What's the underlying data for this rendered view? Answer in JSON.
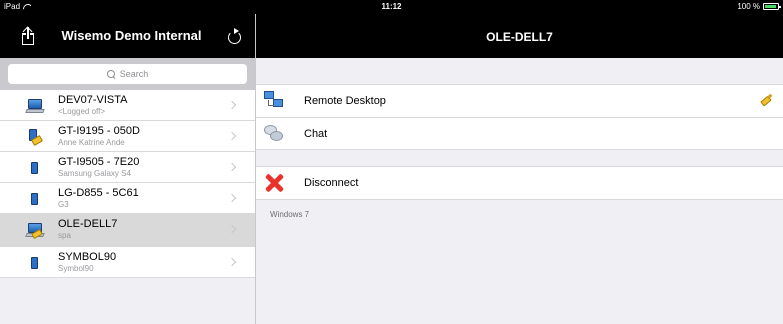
{
  "status_bar": {
    "device": "iPad",
    "time": "11:12",
    "battery": "100 %"
  },
  "left_nav": {
    "title": "Wisemo Demo Internal"
  },
  "right_nav": {
    "title": "OLE-DELL7"
  },
  "search": {
    "placeholder": "Search"
  },
  "devices": [
    {
      "name": "DEV07-VISTA",
      "sub": "<Logged off>",
      "icon": "laptop-icon"
    },
    {
      "name": "GT-I9195 - 050D",
      "sub": "Anne Katrine Ande",
      "icon": "phone-plug-icon"
    },
    {
      "name": "GT-I9505 - 7E20",
      "sub": "Samsung Galaxy S4",
      "icon": "phone-icon"
    },
    {
      "name": "LG-D855 - 5C61",
      "sub": "G3",
      "icon": "phone-icon"
    },
    {
      "name": "OLE-DELL7",
      "sub": "spa",
      "icon": "laptop-plug-icon",
      "selected": true
    },
    {
      "name": "SYMBOL90",
      "sub": "Symbol90",
      "icon": "phone-icon"
    }
  ],
  "actions": {
    "remote_desktop": "Remote Desktop",
    "chat": "Chat",
    "disconnect": "Disconnect"
  },
  "os": "Windows 7"
}
